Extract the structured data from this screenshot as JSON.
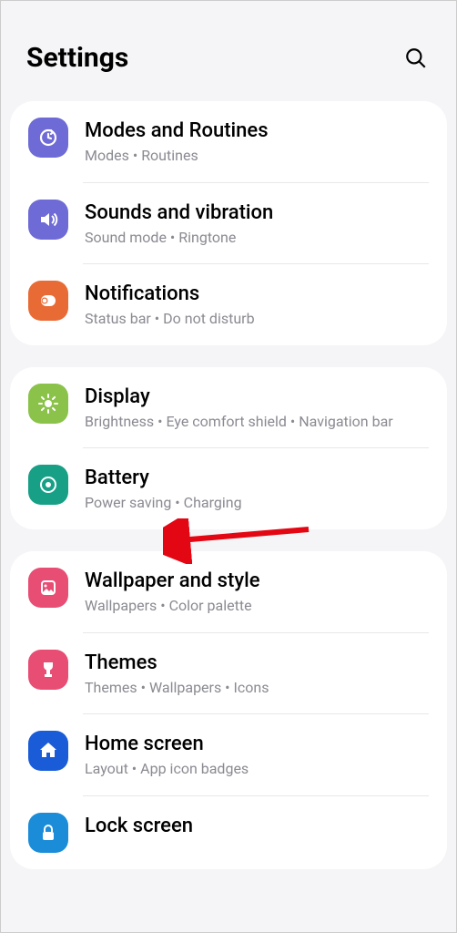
{
  "header": {
    "title": "Settings"
  },
  "groups": [
    {
      "items": [
        {
          "title": "Modes and Routines",
          "sub": "Modes  •  Routines",
          "icon": "modes",
          "color": "#6e6ad6"
        },
        {
          "title": "Sounds and vibration",
          "sub": "Sound mode  •  Ringtone",
          "icon": "sound",
          "color": "#6e6ad6"
        },
        {
          "title": "Notifications",
          "sub": "Status bar  •  Do not disturb",
          "icon": "notifications",
          "color": "#e86b35"
        }
      ]
    },
    {
      "items": [
        {
          "title": "Display",
          "sub": "Brightness  •  Eye comfort shield  •  Navigation bar",
          "icon": "display",
          "color": "#8bc34a"
        },
        {
          "title": "Battery",
          "sub": "Power saving  •  Charging",
          "icon": "battery",
          "color": "#17a086"
        }
      ]
    },
    {
      "items": [
        {
          "title": "Wallpaper and style",
          "sub": "Wallpapers  •  Color palette",
          "icon": "wallpaper",
          "color": "#e84d74"
        },
        {
          "title": "Themes",
          "sub": "Themes  •  Wallpapers  •  Icons",
          "icon": "themes",
          "color": "#e84d74"
        },
        {
          "title": "Home screen",
          "sub": "Layout  •  App icon badges",
          "icon": "home",
          "color": "#1a5cd8"
        },
        {
          "title": "Lock screen",
          "sub": "",
          "icon": "lock",
          "color": "#1a8cd8"
        }
      ]
    }
  ],
  "annotation": {
    "target": "Battery"
  }
}
